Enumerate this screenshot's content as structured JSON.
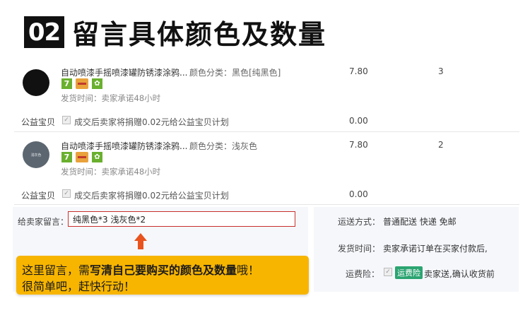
{
  "header": {
    "badge": "02",
    "title": "留言具体颜色及数量"
  },
  "items": [
    {
      "title": "自动喷漆手摇喷漆罐防锈漆涂鸦...",
      "spec": "颜色分类：黑色[纯黑色]",
      "tag_number": "7",
      "shipping_time": "发货时间：卖家承诺48小时",
      "price": "7.80",
      "quantity": "3",
      "charity_label": "公益宝贝",
      "charity_text": "成交后卖家将捐赠0.02元给公益宝贝计划",
      "charity_amount": "0.00"
    },
    {
      "title": "自动喷漆手摇喷漆罐防锈漆涂鸦...",
      "spec": "颜色分类：浅灰色",
      "tag_number": "7",
      "shipping_time": "发货时间：卖家承诺48小时",
      "price": "7.80",
      "quantity": "2",
      "charity_label": "公益宝贝",
      "charity_text": "成交后卖家将捐赠0.02元给公益宝贝计划",
      "charity_amount": "0.00",
      "thumb_text": "浅灰色"
    }
  ],
  "message": {
    "label": "给卖家留言：",
    "value": "纯黑色*3  浅灰色*2"
  },
  "callout": {
    "line1_prefix": "这里留言，需",
    "line1_bold": "写清自己要购买的颜色及数量",
    "line1_suffix": "哦！",
    "line2": "很简单吧，赶快行动！"
  },
  "shipping": {
    "method_label": "运送方式：",
    "method_value": "普通配送 快递 免邮",
    "time_label": "发货时间：",
    "time_value": "卖家承诺订单在买家付款后,",
    "insurance_label": "运费险：",
    "insurance_badge": "运费险",
    "insurance_value": "卖家送,确认收货前"
  },
  "colors": {
    "accent_red": "#c9302c",
    "callout_yellow": "#f7b500",
    "arrow_orange": "#e8531e",
    "badge_green": "#2ba471"
  }
}
